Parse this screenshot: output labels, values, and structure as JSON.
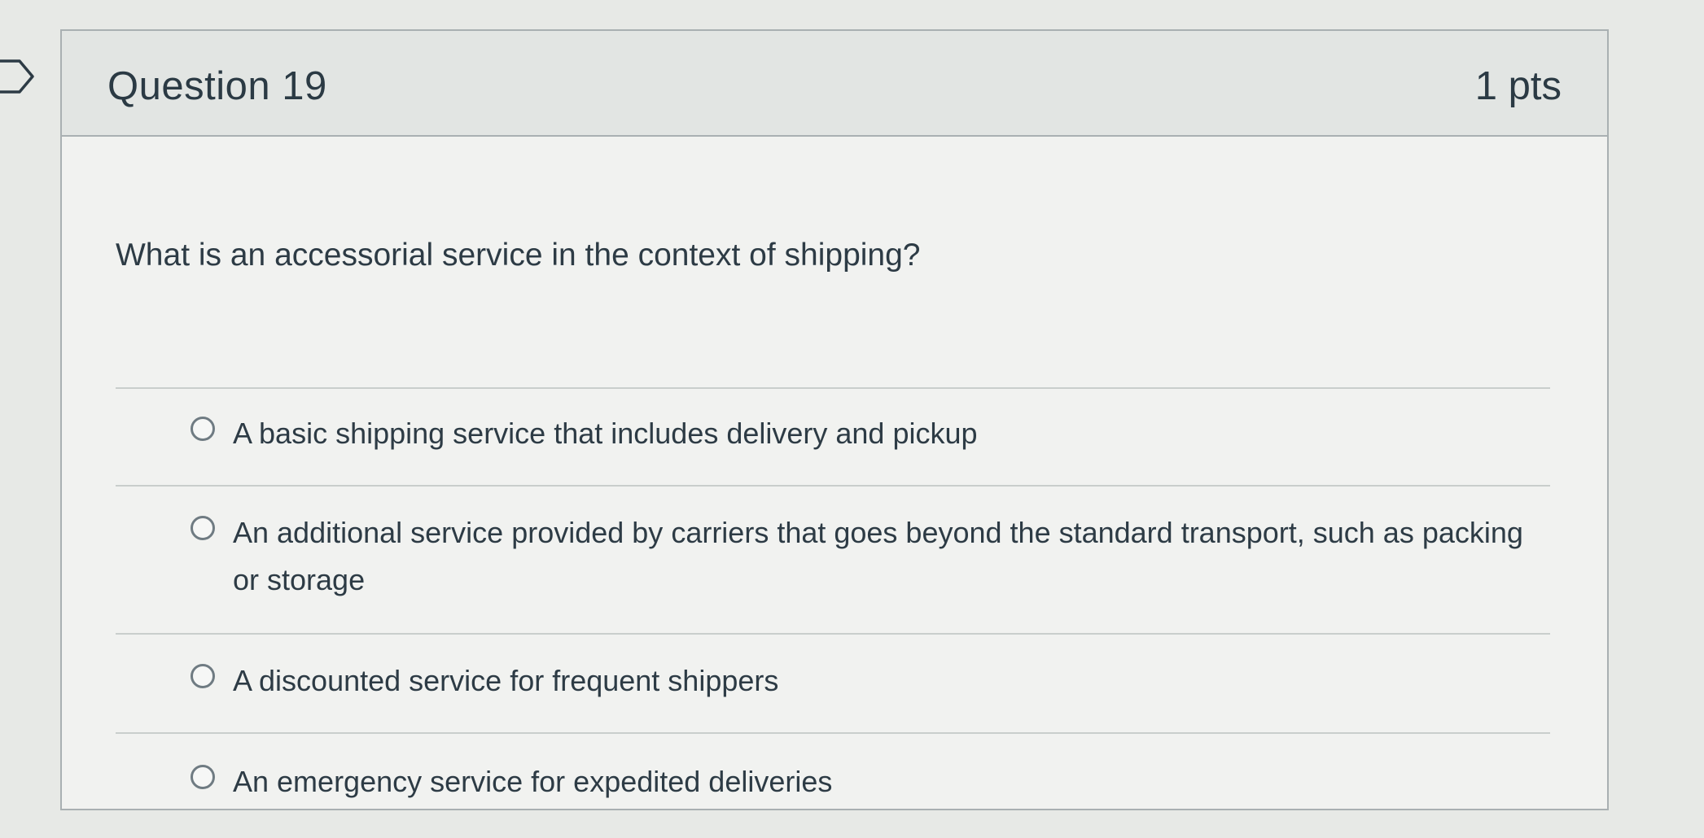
{
  "question": {
    "title": "Question 19",
    "points": "1 pts",
    "prompt": "What is an accessorial service in the context of shipping?",
    "answers": [
      {
        "label": "A basic shipping service that includes delivery and pickup",
        "selected": false
      },
      {
        "label": "An additional service provided by carriers that goes beyond the standard transport, such as packing or storage",
        "selected": false
      },
      {
        "label": "A discounted service for frequent shippers",
        "selected": false
      },
      {
        "label": "An emergency service for expedited deliveries",
        "selected": false
      }
    ]
  },
  "icons": {
    "flag": "bookmark-flag-icon",
    "radio": "radio-button-icon"
  },
  "colors": {
    "background": "#e7e9e6",
    "header_background": "#e2e5e3",
    "card_background": "#f1f2f0",
    "text": "#2d3b45",
    "border": "#a9b0b2"
  }
}
